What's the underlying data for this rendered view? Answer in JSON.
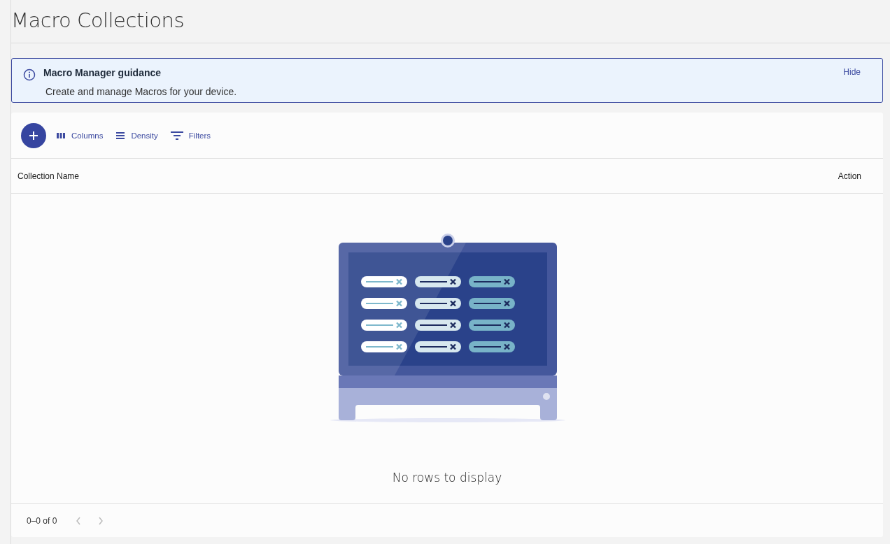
{
  "page_title": "Macro Collections",
  "guidance": {
    "title": "Macro Manager guidance",
    "text": "Create and manage Macros for your device.",
    "hide_label": "Hide"
  },
  "toolbar": [
    {
      "kind": "columns",
      "label": "Columns"
    },
    {
      "kind": "density",
      "label": "Density"
    },
    {
      "kind": "filters",
      "label": "Filters"
    }
  ],
  "table": {
    "columns": [
      "Collection Name",
      "Action"
    ],
    "empty_text": "No rows to display"
  },
  "pagination": {
    "range": "0–0 of 0",
    "previous": {
      "disabled": true
    },
    "next": {
      "disabled": true
    }
  }
}
